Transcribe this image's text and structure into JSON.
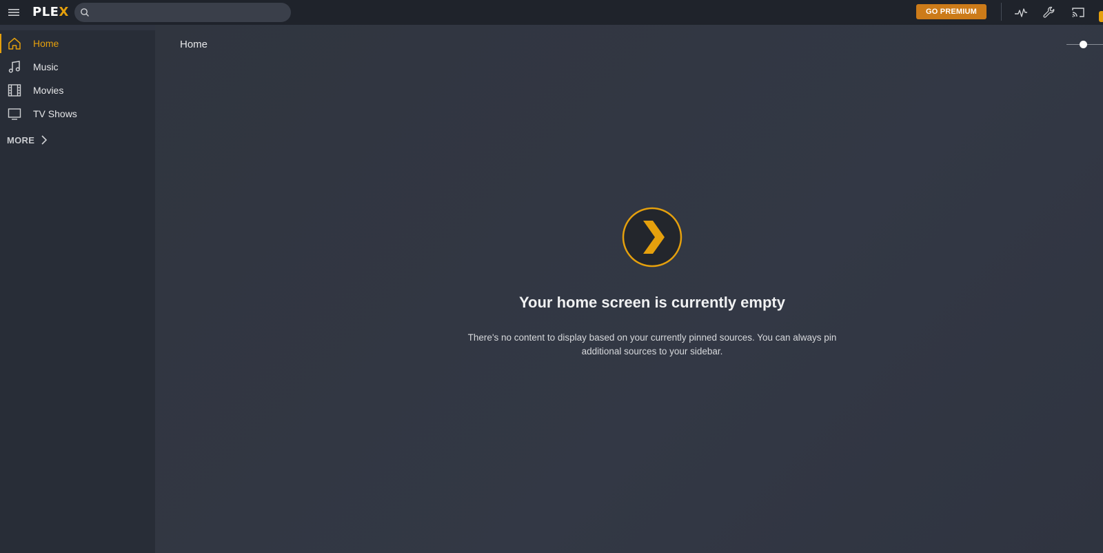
{
  "app": {
    "logo_text": "PLE",
    "logo_accent": "X",
    "accent_color": "#e5a00d",
    "premium_color": "#cc7b19"
  },
  "topbar": {
    "search_placeholder": "",
    "premium_label": "GO PREMIUM",
    "icons": [
      "menu-icon",
      "search-icon",
      "activity-icon",
      "settings-wrench-icon",
      "cast-icon"
    ]
  },
  "sidebar": {
    "items": [
      {
        "label": "Home",
        "icon": "home-icon",
        "active": true
      },
      {
        "label": "Music",
        "icon": "music-icon",
        "active": false
      },
      {
        "label": "Movies",
        "icon": "film-icon",
        "active": false
      },
      {
        "label": "TV Shows",
        "icon": "tv-icon",
        "active": false
      }
    ],
    "more_label": "MORE"
  },
  "main": {
    "title": "Home",
    "empty_title": "Your home screen is currently empty",
    "empty_description": "There's no content to display based on your currently pinned sources. You can always pin additional sources to your sidebar."
  }
}
